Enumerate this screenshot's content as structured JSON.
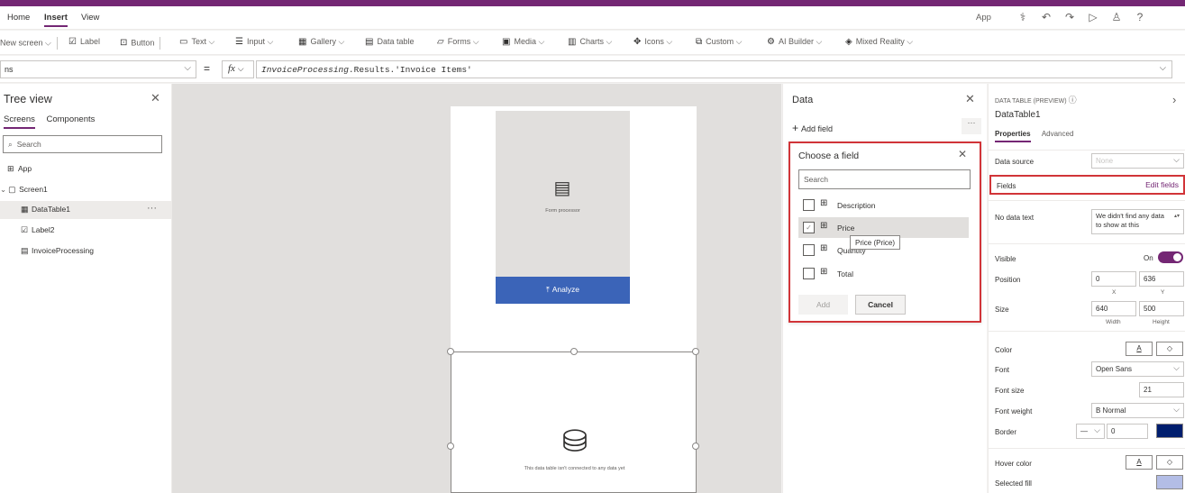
{
  "menubar": {
    "tabs": [
      "Home",
      "Insert",
      "View"
    ],
    "active_tab": "Insert",
    "app_label": "App",
    "icons": [
      "stethoscope-icon",
      "undo-icon",
      "redo-icon",
      "play-icon",
      "person-icon",
      "help-icon"
    ]
  },
  "ribbon": {
    "items": [
      {
        "label": "New screen",
        "icon": "new-screen-icon"
      },
      {
        "label": "Label",
        "icon": "label-icon"
      },
      {
        "label": "Button",
        "icon": "button-icon"
      },
      {
        "label": "Text",
        "icon": "text-icon"
      },
      {
        "label": "Input",
        "icon": "input-icon"
      },
      {
        "label": "Gallery",
        "icon": "gallery-icon"
      },
      {
        "label": "Data table",
        "icon": "data-table-icon"
      },
      {
        "label": "Forms",
        "icon": "forms-icon"
      },
      {
        "label": "Media",
        "icon": "media-icon"
      },
      {
        "label": "Charts",
        "icon": "charts-icon"
      },
      {
        "label": "Icons",
        "icon": "icons-icon"
      },
      {
        "label": "Custom",
        "icon": "custom-icon"
      },
      {
        "label": "AI Builder",
        "icon": "ai-builder-icon"
      },
      {
        "label": "Mixed Reality",
        "icon": "mixed-reality-icon"
      }
    ]
  },
  "formula_bar": {
    "property": "ns",
    "equals": "=",
    "fx": "fx",
    "formula_prefix": "InvoiceProcessing",
    "formula_rest": ".Results.'Invoice Items'"
  },
  "tree_view": {
    "title": "Tree view",
    "tabs": [
      "Screens",
      "Components"
    ],
    "search_placeholder": "Search",
    "items": [
      {
        "label": "App",
        "icon": "app-icon"
      },
      {
        "label": "Screen1",
        "icon": "screen-icon"
      },
      {
        "label": "DataTable1",
        "icon": "data-table-icon",
        "selected": true
      },
      {
        "label": "Label2",
        "icon": "label-icon"
      },
      {
        "label": "InvoiceProcessing",
        "icon": "form-processor-icon"
      }
    ],
    "more": "···"
  },
  "canvas": {
    "form_processor_label": "Form processor",
    "analyze_label": "Analyze",
    "datatable_message": "This data table isn't connected to any data yet"
  },
  "data_panel": {
    "title": "Data",
    "add_field": "Add field",
    "more": "···",
    "choose_field": {
      "title": "Choose a field",
      "search_placeholder": "Search",
      "fields": [
        {
          "label": "Description",
          "checked": false
        },
        {
          "label": "Price",
          "checked": true
        },
        {
          "label": "Quantity",
          "checked": false
        },
        {
          "label": "Total",
          "checked": false
        }
      ],
      "tooltip": "Price (Price)",
      "add_button": "Add",
      "cancel_button": "Cancel"
    }
  },
  "properties": {
    "control_kind": "DATA TABLE (PREVIEW)",
    "control_name": "DataTable1",
    "tabs": [
      "Properties",
      "Advanced"
    ],
    "data_source_label": "Data source",
    "data_source_value": "None",
    "fields_label": "Fields",
    "edit_fields": "Edit fields",
    "no_data_label": "No data text",
    "no_data_value": "We didn't find any data to show at this",
    "visible_label": "Visible",
    "visible_value": "On",
    "position_label": "Position",
    "position_x": "0",
    "position_y": "636",
    "x_label": "X",
    "y_label": "Y",
    "size_label": "Size",
    "width": "640",
    "height": "500",
    "width_label": "Width",
    "height_label": "Height",
    "color_label": "Color",
    "color_text_btn": "A",
    "font_label": "Font",
    "font_value": "Open Sans",
    "font_size_label": "Font size",
    "font_size_value": "21",
    "font_weight_label": "Font weight",
    "font_weight_value": "B  Normal",
    "border_label": "Border",
    "border_value": "0",
    "border_color": "#001e6e",
    "hover_color_label": "Hover color",
    "hover_text_btn": "A",
    "selected_fill_label": "Selected fill",
    "selected_fill_color": "#b3bde6"
  },
  "colors": {
    "brand": "#742774",
    "highlight": "#d13438",
    "analyze": "#3b64b8"
  }
}
